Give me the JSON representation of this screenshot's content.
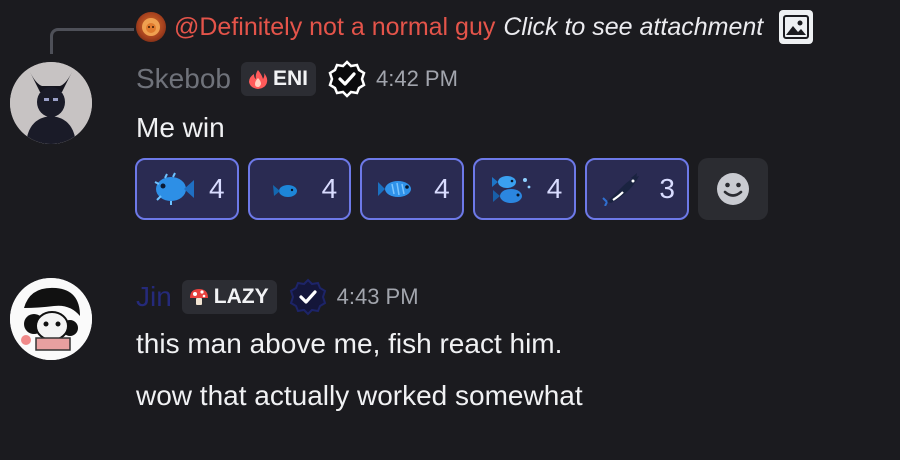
{
  "reply": {
    "author": "@Definitely not a normal guy",
    "text": "Click to see attachment",
    "author_color": "#e4544a"
  },
  "messages": [
    {
      "username": "Skebob",
      "username_color": "#6f727a",
      "tag": "ENI",
      "tag_icon": "fire-icon",
      "timestamp": "4:42 PM",
      "content": [
        "Me win"
      ],
      "reactions": [
        {
          "emoji": "blowfish-icon",
          "count": "4"
        },
        {
          "emoji": "small-fish-icon",
          "count": "4"
        },
        {
          "emoji": "fish-icon",
          "count": "4"
        },
        {
          "emoji": "fish-school-icon",
          "count": "4"
        },
        {
          "emoji": "orca-icon",
          "count": "3"
        }
      ]
    },
    {
      "username": "Jin",
      "username_color": "#252a7a",
      "tag": "LAZY",
      "tag_icon": "mushroom-icon",
      "timestamp": "4:43 PM",
      "content": [
        "this man above me, fish react him.",
        "wow that actually worked somewhat"
      ]
    }
  ],
  "colors": {
    "background": "#1b1b1f",
    "reaction_active_border": "#6d79e8",
    "reaction_active_bg": "#2a2b52"
  }
}
